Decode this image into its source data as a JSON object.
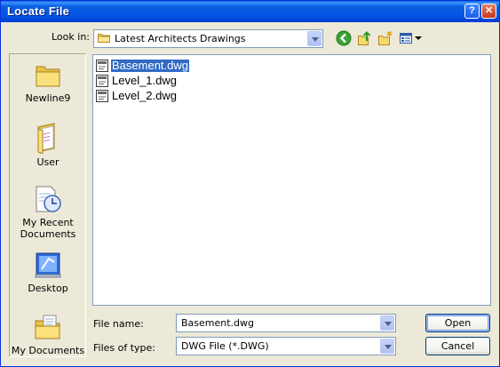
{
  "window": {
    "title": "Locate File",
    "help_label": "?",
    "close_label": "✕"
  },
  "toolbar": {
    "lookin_label": "Look in:",
    "lookin_value": "Latest Architects Drawings",
    "icons": [
      "back-icon",
      "up-folder-icon",
      "new-folder-icon",
      "views-menu-icon"
    ]
  },
  "places": [
    {
      "label": "Newline9",
      "icon": "folder-icon"
    },
    {
      "label": "User",
      "icon": "user-folder-icon"
    },
    {
      "label": "My Recent Documents",
      "icon": "recent-documents-icon"
    },
    {
      "label": "Desktop",
      "icon": "desktop-icon"
    },
    {
      "label": "My Documents",
      "icon": "my-documents-icon"
    }
  ],
  "files": [
    {
      "name": "Basement.dwg",
      "selected": true
    },
    {
      "name": "Level_1.dwg",
      "selected": false
    },
    {
      "name": "Level_2.dwg",
      "selected": false
    }
  ],
  "bottom": {
    "filename_label": "File name:",
    "filename_value": "Basement.dwg",
    "filetype_label": "Files of type:",
    "filetype_value": "DWG File (*.DWG)",
    "open_label": "Open",
    "cancel_label": "Cancel"
  },
  "colors": {
    "titlebar": "#0a5fe0",
    "dialog_bg": "#ece9d8",
    "selection": "#316ac5"
  }
}
